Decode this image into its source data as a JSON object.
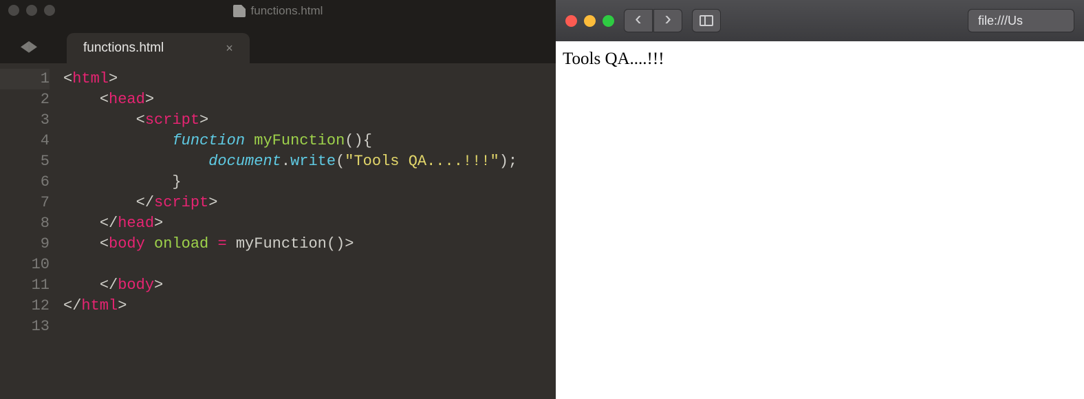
{
  "editor": {
    "window_title": "functions.html",
    "tab_label": "functions.html",
    "tab_close_glyph": "×",
    "nav_prev_glyph": "◀",
    "nav_next_glyph": "▶",
    "line_numbers": [
      "1",
      "2",
      "3",
      "4",
      "5",
      "6",
      "7",
      "8",
      "9",
      "10",
      "11",
      "12",
      "13"
    ],
    "code_lines": [
      [
        {
          "t": "<",
          "c": "pn"
        },
        {
          "t": "html",
          "c": "tag"
        },
        {
          "t": ">",
          "c": "pn"
        }
      ],
      [
        {
          "t": "    ",
          "c": "pn"
        },
        {
          "t": "<",
          "c": "pn"
        },
        {
          "t": "head",
          "c": "tag"
        },
        {
          "t": ">",
          "c": "pn"
        }
      ],
      [
        {
          "t": "        ",
          "c": "pn"
        },
        {
          "t": "<",
          "c": "pn"
        },
        {
          "t": "script",
          "c": "tag"
        },
        {
          "t": ">",
          "c": "pn"
        }
      ],
      [
        {
          "t": "            ",
          "c": "pn"
        },
        {
          "t": "function",
          "c": "kw"
        },
        {
          "t": " ",
          "c": "pn"
        },
        {
          "t": "myFunction",
          "c": "fn"
        },
        {
          "t": "(){",
          "c": "pn"
        }
      ],
      [
        {
          "t": "                ",
          "c": "pn"
        },
        {
          "t": "document",
          "c": "obj"
        },
        {
          "t": ".",
          "c": "pn"
        },
        {
          "t": "write",
          "c": "mth"
        },
        {
          "t": "(",
          "c": "pn"
        },
        {
          "t": "\"Tools QA....!!!\"",
          "c": "str"
        },
        {
          "t": ");",
          "c": "pn"
        }
      ],
      [
        {
          "t": "            }",
          "c": "pn"
        }
      ],
      [
        {
          "t": "        ",
          "c": "pn"
        },
        {
          "t": "</",
          "c": "pn"
        },
        {
          "t": "script",
          "c": "tag"
        },
        {
          "t": ">",
          "c": "pn"
        }
      ],
      [
        {
          "t": "    ",
          "c": "pn"
        },
        {
          "t": "</",
          "c": "pn"
        },
        {
          "t": "head",
          "c": "tag"
        },
        {
          "t": ">",
          "c": "pn"
        }
      ],
      [
        {
          "t": "    ",
          "c": "pn"
        },
        {
          "t": "<",
          "c": "pn"
        },
        {
          "t": "body",
          "c": "tag"
        },
        {
          "t": " ",
          "c": "pn"
        },
        {
          "t": "onload",
          "c": "attr"
        },
        {
          "t": " ",
          "c": "pn"
        },
        {
          "t": "=",
          "c": "tag"
        },
        {
          "t": " ",
          "c": "pn"
        },
        {
          "t": "myFunction",
          "c": "val"
        },
        {
          "t": "()>",
          "c": "pn"
        }
      ],
      [
        {
          "t": "",
          "c": "pn"
        }
      ],
      [
        {
          "t": "    ",
          "c": "pn"
        },
        {
          "t": "</",
          "c": "pn"
        },
        {
          "t": "body",
          "c": "tag"
        },
        {
          "t": ">",
          "c": "pn"
        }
      ],
      [
        {
          "t": "</",
          "c": "pn"
        },
        {
          "t": "html",
          "c": "tag"
        },
        {
          "t": ">",
          "c": "pn"
        }
      ],
      [
        {
          "t": "",
          "c": "pn"
        }
      ]
    ]
  },
  "browser": {
    "back_glyph": "‹",
    "forward_glyph": "›",
    "address": "file:///Us",
    "page_output": "Tools QA....!!!"
  }
}
